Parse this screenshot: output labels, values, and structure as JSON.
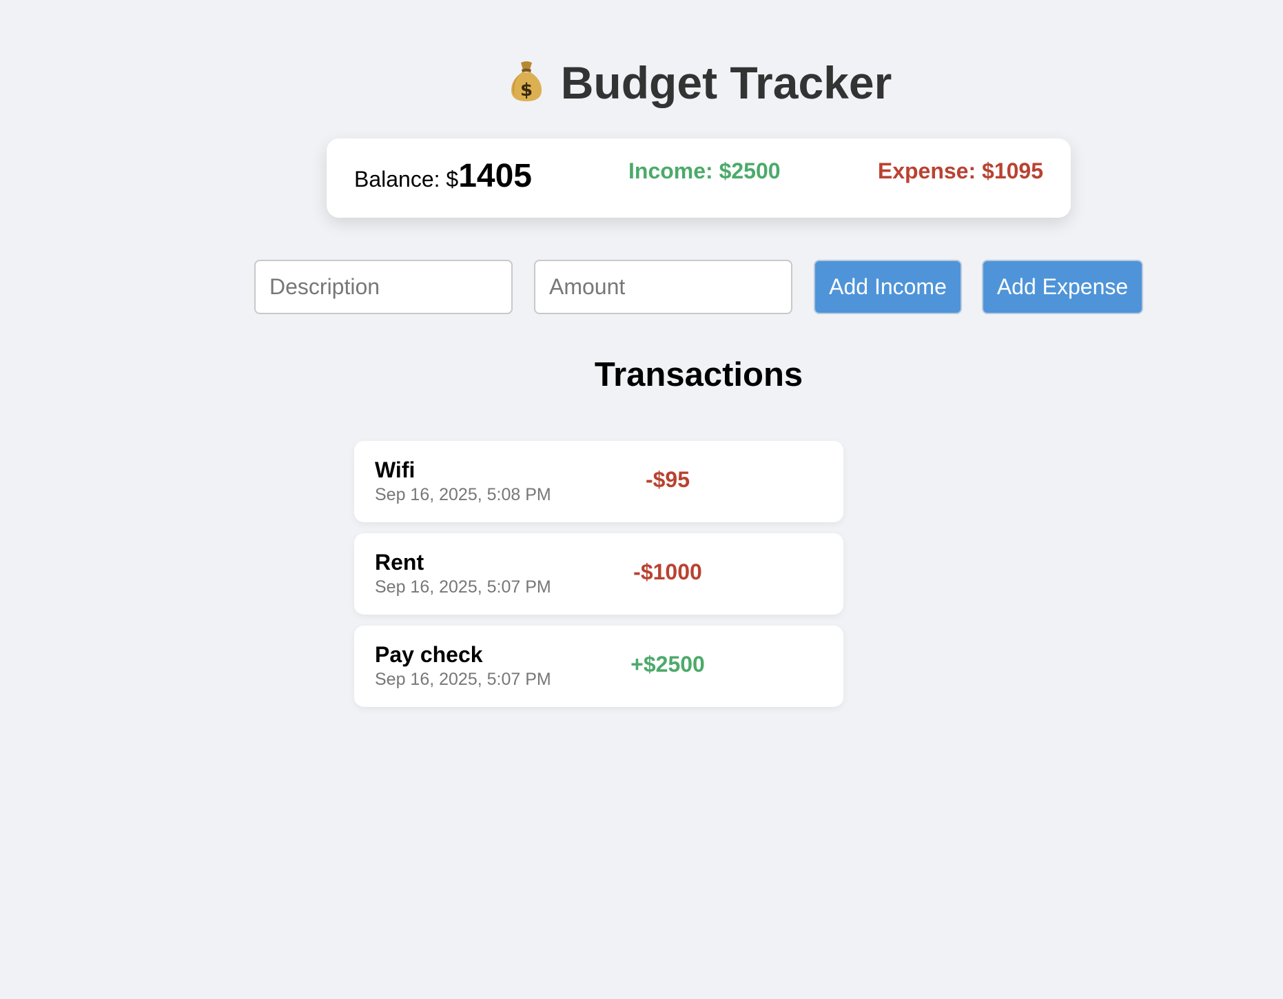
{
  "app": {
    "title": "Budget Tracker",
    "title_icon": "money-bag-icon"
  },
  "summary": {
    "balance_label": "Balance: $",
    "balance_value": "1405",
    "income_text": "Income: $2500",
    "expense_text": "Expense: $1095"
  },
  "form": {
    "description_placeholder": "Description",
    "amount_placeholder": "Amount",
    "add_income_label": "Add Income",
    "add_expense_label": "Add Expense"
  },
  "transactions": {
    "heading": "Transactions",
    "items": [
      {
        "description": "Wifi",
        "date": "Sep 16, 2025, 5:08 PM",
        "amount": "-$95",
        "type": "expense"
      },
      {
        "description": "Rent",
        "date": "Sep 16, 2025, 5:07 PM",
        "amount": "-$1000",
        "type": "expense"
      },
      {
        "description": "Pay check",
        "date": "Sep 16, 2025, 5:07 PM",
        "amount": "+$2500",
        "type": "income"
      }
    ]
  },
  "colors": {
    "background": "#f0f2f6",
    "income": "#4caa6a",
    "expense": "#b94231",
    "button": "#4f94d8",
    "title": "#333333"
  }
}
